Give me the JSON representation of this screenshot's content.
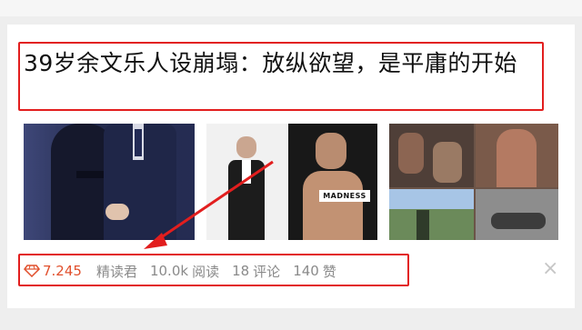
{
  "article": {
    "title": "39岁余文乐人设崩塌：放纵欲望，是平庸的开始",
    "image_text": "MADNESS"
  },
  "meta": {
    "score": "7.245",
    "author": "精读君",
    "reads_count": "10.0k",
    "reads_label": "阅读",
    "comments_count": "18",
    "comments_label": "评论",
    "likes_count": "140",
    "likes_label": "赞"
  },
  "colors": {
    "highlight_red": "#e21e1e",
    "score_orange": "#e1502d",
    "meta_gray": "#8a8a8a"
  },
  "icons": {
    "score": "diamond-icon",
    "close": "close-icon"
  }
}
